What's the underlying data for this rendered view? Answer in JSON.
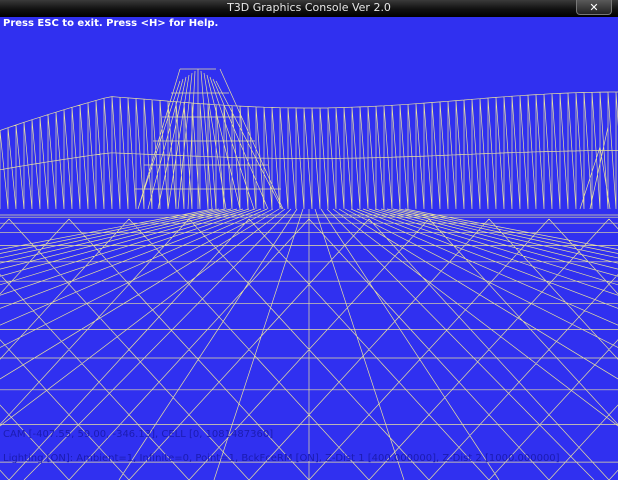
{
  "window": {
    "title": "T3D Graphics Console Ver 2.0",
    "close_glyph": "✕"
  },
  "hud": {
    "help_text": "Press ESC to exit. Press <H> for Help.",
    "cam_text": "CAM [-407.55, 59.00, -346.13], CELL [0, 1081487360]",
    "lighting_text": "Lighting [ON]: Ambient=1, Infinite=0, Point=1, BckFceRM [ON], Z-Dist 1 [400.000000], Z-Dist 2 [1000.000000]"
  },
  "colors": {
    "background": "#3030f0",
    "wireframe": "#e8e0a0",
    "hud_text": "#1c1cb0",
    "help_text": "#ffffff"
  }
}
